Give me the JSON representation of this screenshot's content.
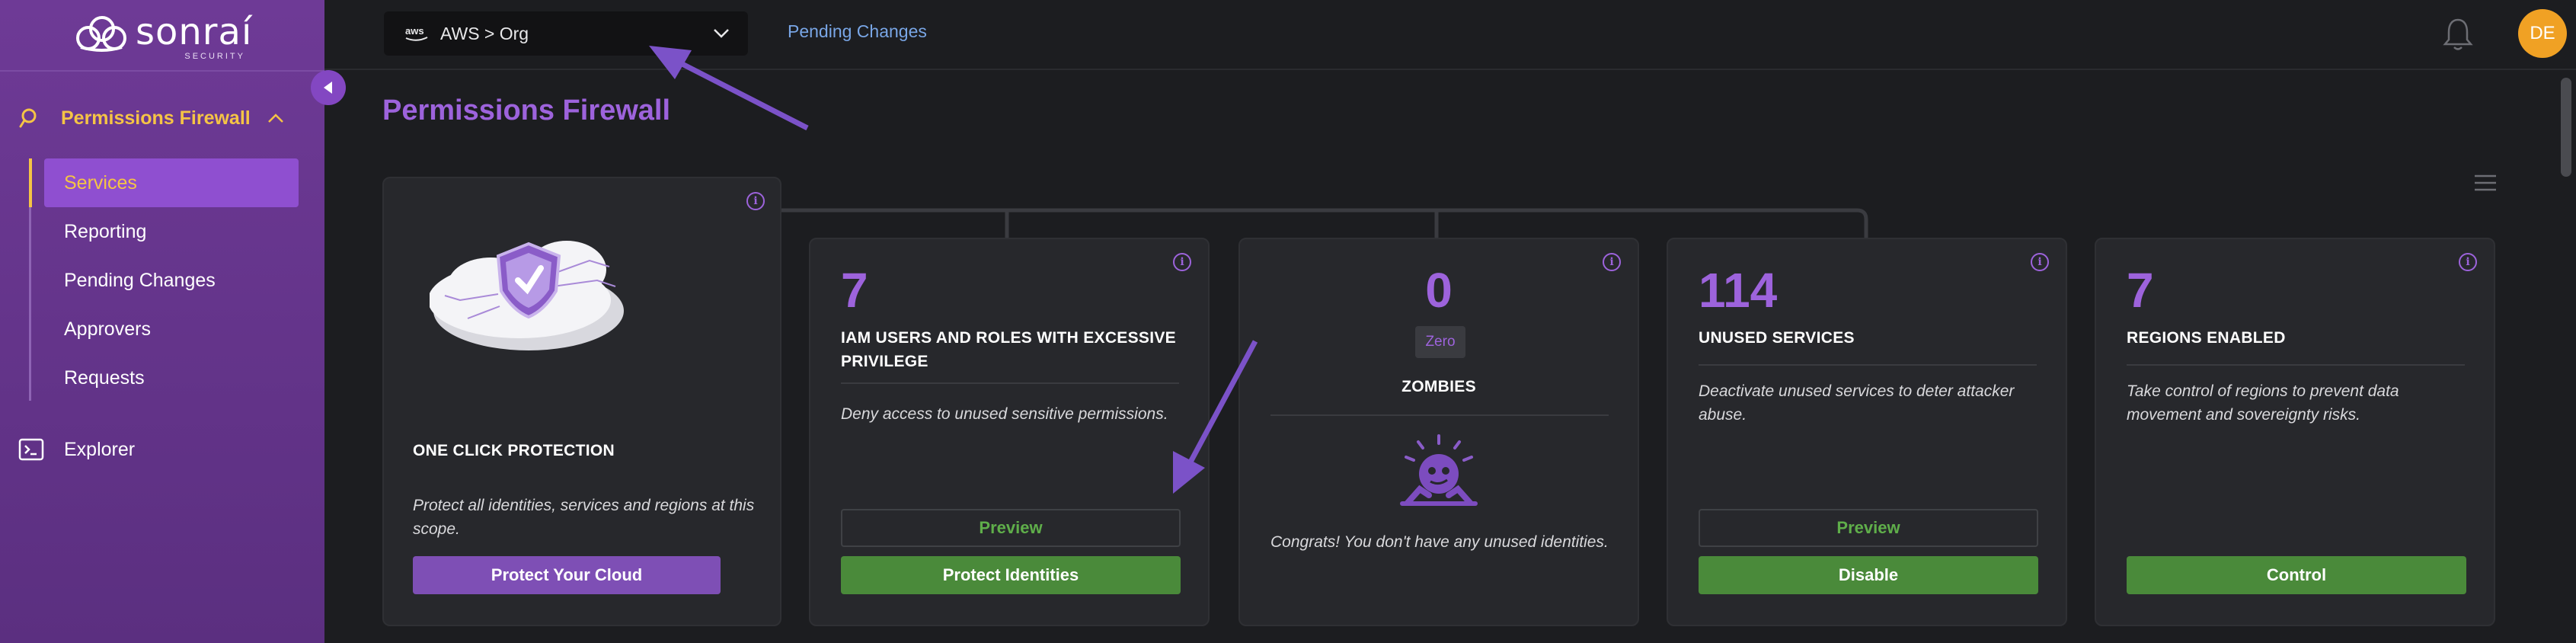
{
  "brand": {
    "name": "sonraí",
    "sub": "SECURITY"
  },
  "sidebar": {
    "section_label": "Permissions Firewall",
    "items": [
      {
        "label": "Services",
        "active": true
      },
      {
        "label": "Reporting"
      },
      {
        "label": "Pending Changes"
      },
      {
        "label": "Approvers"
      },
      {
        "label": "Requests"
      }
    ],
    "explorer_label": "Explorer"
  },
  "topbar": {
    "scope_provider": "aws",
    "scope_text": "AWS > Org",
    "pending_link": "Pending Changes",
    "avatar_initials": "DE"
  },
  "main": {
    "title": "Permissions Firewall",
    "cards": {
      "protection": {
        "heading": "ONE CLICK PROTECTION",
        "desc": "Protect all identities, services and regions at this scope.",
        "button": "Protect Your Cloud"
      },
      "iam": {
        "count": "7",
        "heading": "IAM USERS AND ROLES WITH EXCESSIVE PRIVILEGE",
        "desc": "Deny access to unused sensitive permissions.",
        "preview": "Preview",
        "button": "Protect Identities"
      },
      "zombies": {
        "count": "0",
        "badge": "Zero",
        "heading": "ZOMBIES",
        "desc": "Congrats! You don't have any unused identities."
      },
      "unused": {
        "count": "114",
        "heading": "UNUSED SERVICES",
        "desc": "Deactivate unused services to deter attacker abuse.",
        "preview": "Preview",
        "button": "Disable"
      },
      "regions": {
        "count": "7",
        "heading": "REGIONS ENABLED",
        "desc": "Take control of regions to prevent data movement and sovereignty risks.",
        "button": "Control"
      }
    }
  },
  "colors": {
    "sidebar": "#6e3a96",
    "accent_purple": "#9d63dc",
    "accent_yellow": "#f5c445",
    "green": "#4a8a3a",
    "avatar": "#f0a124",
    "annotation_arrow": "#7b52c8"
  },
  "icons": [
    "shield-cloud-icon",
    "fingerprint-icon",
    "chevron-up-icon",
    "terminal-icon",
    "bell-icon",
    "info-icon",
    "menu-icon",
    "zombie-icon",
    "chevron-down-icon",
    "collapse-icon"
  ]
}
